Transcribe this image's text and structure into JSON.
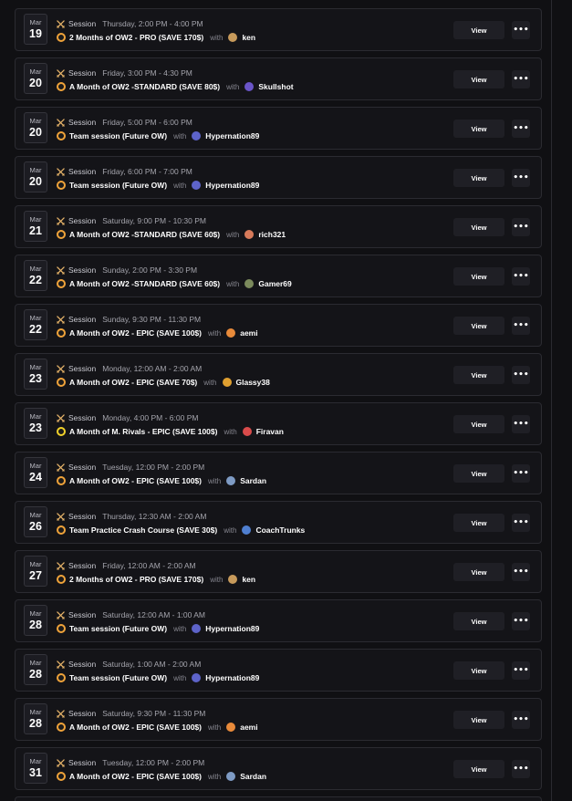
{
  "common": {
    "session_label": "Session",
    "with_label": "with",
    "view_label": "View",
    "more_label": "•••"
  },
  "colors": {
    "background": "#101013",
    "card": "#141418",
    "card_border": "#2b2b31",
    "button": "#1f1f25",
    "session_icon": "#e8b56a",
    "ow2_icon": "#f0a33a",
    "rivals_icon": "#f2d22a"
  },
  "sessions": [
    {
      "month": "Mar",
      "day": "19",
      "time": "Thursday, 2:00 PM - 4:00 PM",
      "product": "2 Months of OW2 - PRO (SAVE 170$)",
      "product_icon": "ow2-logo-icon",
      "coach": "ken",
      "avatar_color": "#c79a5b"
    },
    {
      "month": "Mar",
      "day": "20",
      "time": "Friday, 3:00 PM - 4:30 PM",
      "product": "A Month of OW2 -STANDARD (SAVE 80$)",
      "product_icon": "ow2-logo-icon",
      "coach": "Skullshot",
      "avatar_color": "#6a55c8"
    },
    {
      "month": "Mar",
      "day": "20",
      "time": "Friday, 5:00 PM - 6:00 PM",
      "product": "Team session (Future OW)",
      "product_icon": "ow2-logo-icon",
      "coach": "Hypernation89",
      "avatar_color": "#5d63c9"
    },
    {
      "month": "Mar",
      "day": "20",
      "time": "Friday, 6:00 PM - 7:00 PM",
      "product": "Team session (Future OW)",
      "product_icon": "ow2-logo-icon",
      "coach": "Hypernation89",
      "avatar_color": "#5d63c9"
    },
    {
      "month": "Mar",
      "day": "21",
      "time": "Saturday, 9:00 PM - 10:30 PM",
      "product": "A Month of OW2 -STANDARD (SAVE 60$)",
      "product_icon": "ow2-logo-icon",
      "coach": "rich321",
      "avatar_color": "#d77a5a"
    },
    {
      "month": "Mar",
      "day": "22",
      "time": "Sunday, 2:00 PM - 3:30 PM",
      "product": "A Month of OW2 -STANDARD (SAVE 60$)",
      "product_icon": "ow2-logo-icon",
      "coach": "Gamer69",
      "avatar_color": "#7b8a5c"
    },
    {
      "month": "Mar",
      "day": "22",
      "time": "Sunday, 9:30 PM - 11:30 PM",
      "product": "A Month of OW2 - EPIC (SAVE 100$)",
      "product_icon": "ow2-logo-icon",
      "coach": "aemi",
      "avatar_color": "#e88a3a"
    },
    {
      "month": "Mar",
      "day": "23",
      "time": "Monday, 12:00 AM - 2:00 AM",
      "product": "A Month of OW2 - EPIC (SAVE 70$)",
      "product_icon": "ow2-logo-icon",
      "coach": "Glassy38",
      "avatar_color": "#e0a030"
    },
    {
      "month": "Mar",
      "day": "23",
      "time": "Monday, 4:00 PM - 6:00 PM",
      "product": "A Month of M. Rivals - EPIC (SAVE 100$)",
      "product_icon": "rivals-logo-icon",
      "coach": "Firavan",
      "avatar_color": "#d94b4b"
    },
    {
      "month": "Mar",
      "day": "24",
      "time": "Tuesday, 12:00 PM - 2:00 PM",
      "product": "A Month of OW2 - EPIC (SAVE 100$)",
      "product_icon": "ow2-logo-icon",
      "coach": "Sardan",
      "avatar_color": "#7e9bc4"
    },
    {
      "month": "Mar",
      "day": "26",
      "time": "Thursday, 12:30 AM - 2:00 AM",
      "product": "Team Practice Crash Course (SAVE 30$)",
      "product_icon": "ow2-logo-icon",
      "coach": "CoachTrunks",
      "avatar_color": "#4f7fd0"
    },
    {
      "month": "Mar",
      "day": "27",
      "time": "Friday, 12:00 AM - 2:00 AM",
      "product": "2 Months of OW2 - PRO (SAVE 170$)",
      "product_icon": "ow2-logo-icon",
      "coach": "ken",
      "avatar_color": "#c79a5b"
    },
    {
      "month": "Mar",
      "day": "28",
      "time": "Saturday, 12:00 AM - 1:00 AM",
      "product": "Team session (Future OW)",
      "product_icon": "ow2-logo-icon",
      "coach": "Hypernation89",
      "avatar_color": "#5d63c9"
    },
    {
      "month": "Mar",
      "day": "28",
      "time": "Saturday, 1:00 AM - 2:00 AM",
      "product": "Team session (Future OW)",
      "product_icon": "ow2-logo-icon",
      "coach": "Hypernation89",
      "avatar_color": "#5d63c9"
    },
    {
      "month": "Mar",
      "day": "28",
      "time": "Saturday, 9:30 PM - 11:30 PM",
      "product": "A Month of OW2 - EPIC (SAVE 100$)",
      "product_icon": "ow2-logo-icon",
      "coach": "aemi",
      "avatar_color": "#e88a3a"
    },
    {
      "month": "Mar",
      "day": "31",
      "time": "Tuesday, 12:00 PM - 2:00 PM",
      "product": "A Month of OW2 - EPIC (SAVE 100$)",
      "product_icon": "ow2-logo-icon",
      "coach": "Sardan",
      "avatar_color": "#7e9bc4"
    }
  ]
}
